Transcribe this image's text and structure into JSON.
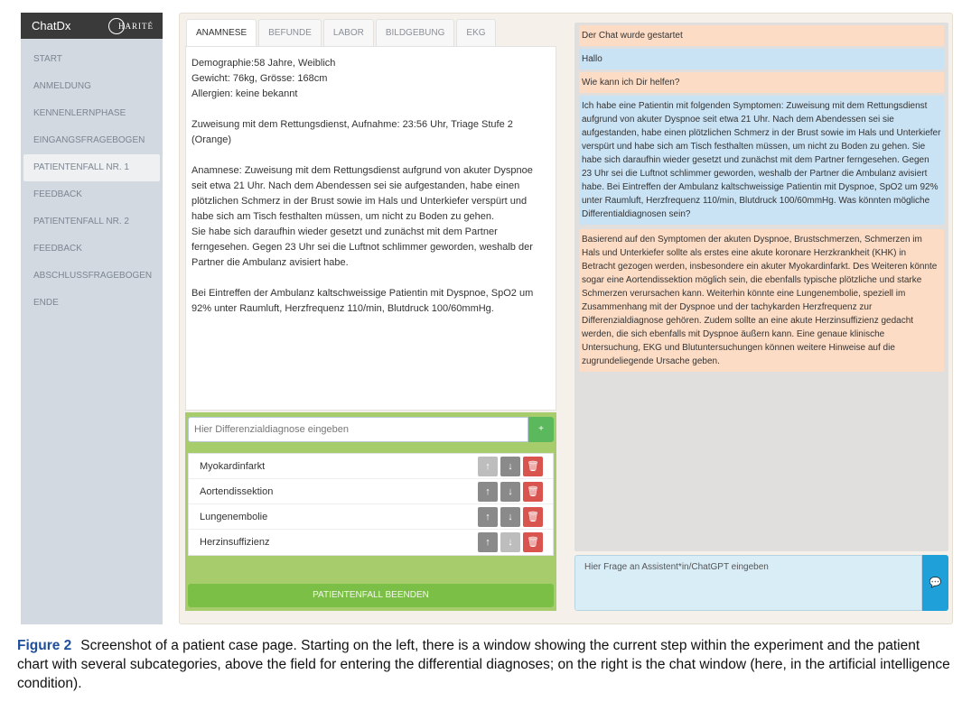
{
  "sidebar": {
    "brand": "ChatDx",
    "logo_text": "HARITÉ",
    "items": [
      {
        "label": "START"
      },
      {
        "label": "ANMELDUNG"
      },
      {
        "label": "KENNENLERNPHASE"
      },
      {
        "label": "EINGANGSFRAGEBOGEN"
      },
      {
        "label": "PATIENTENFALL NR. 1",
        "active": true
      },
      {
        "label": "FEEDBACK"
      },
      {
        "label": "PATIENTENFALL NR. 2"
      },
      {
        "label": "FEEDBACK"
      },
      {
        "label": "ABSCHLUSSFRAGEBOGEN"
      },
      {
        "label": "ENDE"
      }
    ]
  },
  "tabs": [
    {
      "label": "ANAMNESE",
      "active": true
    },
    {
      "label": "BEFUNDE"
    },
    {
      "label": "LABOR"
    },
    {
      "label": "BILDGEBUNG"
    },
    {
      "label": "EKG"
    }
  ],
  "chart": {
    "demographics": "Demographie:58 Jahre, Weiblich",
    "weight": "Gewicht: 76kg, Grösse: 168cm",
    "allergies": "Allergien: keine bekannt",
    "admission": "Zuweisung mit dem Rettungsdienst, Aufnahme: 23:56 Uhr, Triage Stufe 2 (Orange)",
    "anamnesis_1": "Anamnese: Zuweisung mit dem Rettungsdienst aufgrund von akuter Dyspnoe seit etwa 21 Uhr. Nach dem Abendessen sei sie aufgestanden, habe einen plötzlichen Schmerz in der Brust sowie im Hals und Unterkiefer verspürt und habe sich am Tisch festhalten müssen, um nicht zu Boden zu gehen.",
    "anamnesis_2": "Sie habe sich daraufhin wieder gesetzt und zunächst mit dem Partner ferngesehen. Gegen 23 Uhr sei die Luftnot schlimmer geworden, weshalb der Partner die Ambulanz avisiert habe.",
    "arrival": "Bei Eintreffen der Ambulanz kaltschweissige Patientin mit Dyspnoe, SpO2 um 92% unter Raumluft, Herzfrequenz 110/min, Blutdruck 100/60mmHg."
  },
  "diagnosis": {
    "placeholder": "Hier Differenzialdiagnose eingeben",
    "add_label": "+",
    "items": [
      {
        "label": "Myokardinfarkt"
      },
      {
        "label": "Aortendissektion"
      },
      {
        "label": "Lungenembolie"
      },
      {
        "label": "Herzinsuffizienz"
      }
    ],
    "finish_label": "PATIENTENFALL BEENDEN"
  },
  "chat": {
    "messages": [
      {
        "role": "bot",
        "text": "Der Chat wurde gestartet"
      },
      {
        "role": "user",
        "text": "Hallo"
      },
      {
        "role": "bot",
        "text": "Wie kann ich Dir helfen?"
      },
      {
        "role": "user",
        "text": "Ich habe eine Patientin mit folgenden Symptomen: Zuweisung mit dem Rettungsdienst aufgrund von akuter Dyspnoe seit etwa 21 Uhr. Nach dem Abendessen sei sie aufgestanden, habe einen plötzlichen Schmerz in der Brust sowie im Hals und Unterkiefer verspürt und habe sich am Tisch festhalten müssen, um nicht zu Boden zu gehen. Sie habe sich daraufhin wieder gesetzt und zunächst mit dem Partner ferngesehen. Gegen 23 Uhr sei die Luftnot schlimmer geworden, weshalb der Partner die Ambulanz avisiert habe. Bei Eintreffen der Ambulanz kaltschweissige Patientin mit Dyspnoe, SpO2 um 92% unter Raumluft, Herzfrequenz 110/min, Blutdruck 100/60mmHg. Was könnten mögliche Differentialdiagnosen sein?"
      },
      {
        "role": "bot",
        "text": "Basierend auf den Symptomen der akuten Dyspnoe, Brustschmerzen, Schmerzen im Hals und Unterkiefer sollte als erstes eine akute koronare Herzkrankheit (KHK) in Betracht gezogen werden, insbesondere ein akuter Myokardinfarkt. Des Weiteren könnte sogar eine Aortendissektion möglich sein, die ebenfalls typische plötzliche und starke Schmerzen verursachen kann. Weiterhin könnte eine Lungenembolie, speziell im Zusammenhang mit der Dyspnoe und der tachykarden Herzfrequenz zur Differenzialdiagnose gehören. Zudem sollte an eine akute Herzinsuffizienz gedacht werden, die sich ebenfalls mit Dyspnoe äußern kann. Eine genaue klinische Untersuchung, EKG und Blutuntersuchungen können weitere Hinweise auf die zugrundeliegende Ursache geben."
      }
    ],
    "input_placeholder": "Hier Frage an Assistent*in/ChatGPT eingeben"
  },
  "caption": {
    "label": "Figure 2",
    "text": "Screenshot of a patient case page. Starting on the left, there is a window showing the current step within the experiment and the patient chart with several subcategories, above the field for entering the differential diagnoses; on the right is the chat window (here, in the artificial intelligence condition)."
  },
  "colors": {
    "sidebar_header": "#3a3a3a",
    "sidebar_bg": "#d3d9e0",
    "diagnosis_area": "#a6cc6b",
    "finish_button": "#7cbf47",
    "bot_message": "#fcdcc5",
    "user_message": "#c9e3f5",
    "send_button": "#20a0d8",
    "delete_button": "#d9534f",
    "caption_label": "#1f4e9c"
  }
}
